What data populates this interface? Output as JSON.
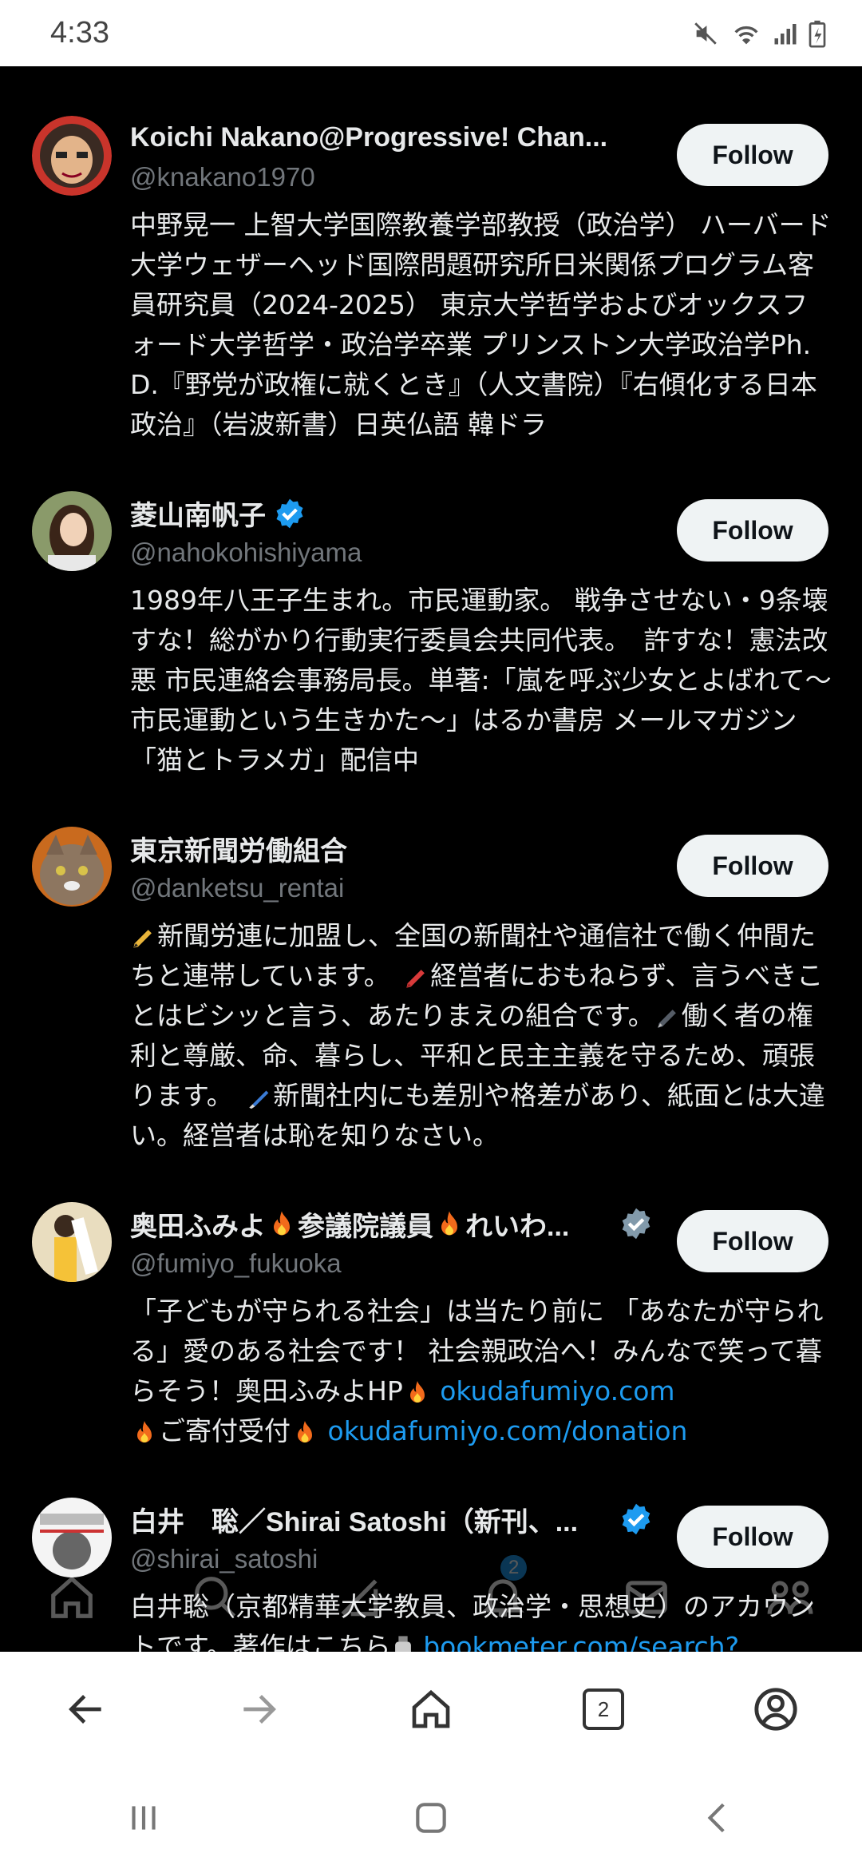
{
  "status_bar": {
    "time": "4:33"
  },
  "follow_label": "Follow",
  "accounts": [
    {
      "name": "Koichi Nakano@Progressive! Chan...",
      "handle": "@knakano1970",
      "verified": false,
      "bio": "中野晃一 上智大学国際教養学部教授（政治学） ハーバード大学ウェザーヘッド国際問題研究所日米関係プログラム客員研究員（2024-2025） 東京大学哲学およびオックスフォード大学哲学・政治学卒業 プリンストン大学政治学Ph.D.『野党が政権に就くとき』（人文書院）『右傾化する日本政治』（岩波新書）日英仏語 韓ドラ"
    },
    {
      "name": "菱山南帆子",
      "handle": "@nahokohishiyama",
      "verified": true,
      "bio": "1989年八王子生まれ。市民運動家。 戦争させない・9条壊すな！総がかり行動実行委員会共同代表。　許すな！憲法改悪 市民連絡会事務局長。単著:「嵐を呼ぶ少女とよばれて〜市民運動という生きかた〜」はるか書房 メールマガジン「猫とトラメガ」配信中"
    },
    {
      "name": "東京新聞労働組合",
      "handle": "@danketsu_rentai",
      "verified": false,
      "bio_parts": [
        "新聞労連に加盟し、全国の新聞社や通信社で働く仲間たちと連帯しています。　",
        "経営者におもねらず、言うべきことはビシッと言う、あたりまえの組合です。",
        "働く者の権利と尊厳、命、暮らし、平和と民主主義を守るため、頑張ります。　",
        "新聞社内にも差別や格差があり、紙面とは大違い。経営者は恥を知りなさい。"
      ]
    },
    {
      "name_parts": [
        "奥田ふみよ",
        "参議院議員",
        "れいわ..."
      ],
      "handle": "@fumiyo_fukuoka",
      "verified": true,
      "bio_text1": "「子どもが守られる社会」は当たり前に 「あなたが守られる」愛のある社会です！ 社会親政治へ！みんなで笑って暮らそう！奥田ふみよHP",
      "bio_link1": "okudafumiyo.com",
      "bio_text2": "ご寄付受付",
      "bio_link2": "okudafumiyo.com/donation"
    },
    {
      "name": "白井　聡／Shirai Satoshi（新刊、...",
      "handle": "@shirai_satoshi",
      "verified": true,
      "bio_text": "白井聡（京都精華大学教員、政治学・思想史）のアカウントです。著作はこちら",
      "bio_link": "bookmeter.com/search?"
    }
  ],
  "ghost_nav": {
    "notification_count": "2"
  },
  "browser_bar": {
    "tab_count": "2"
  },
  "colors": {
    "link": "#1d9bf0",
    "verified": "#1d9bf0",
    "verified_gray": "#829aab",
    "follow_bg": "#eff3f4"
  }
}
